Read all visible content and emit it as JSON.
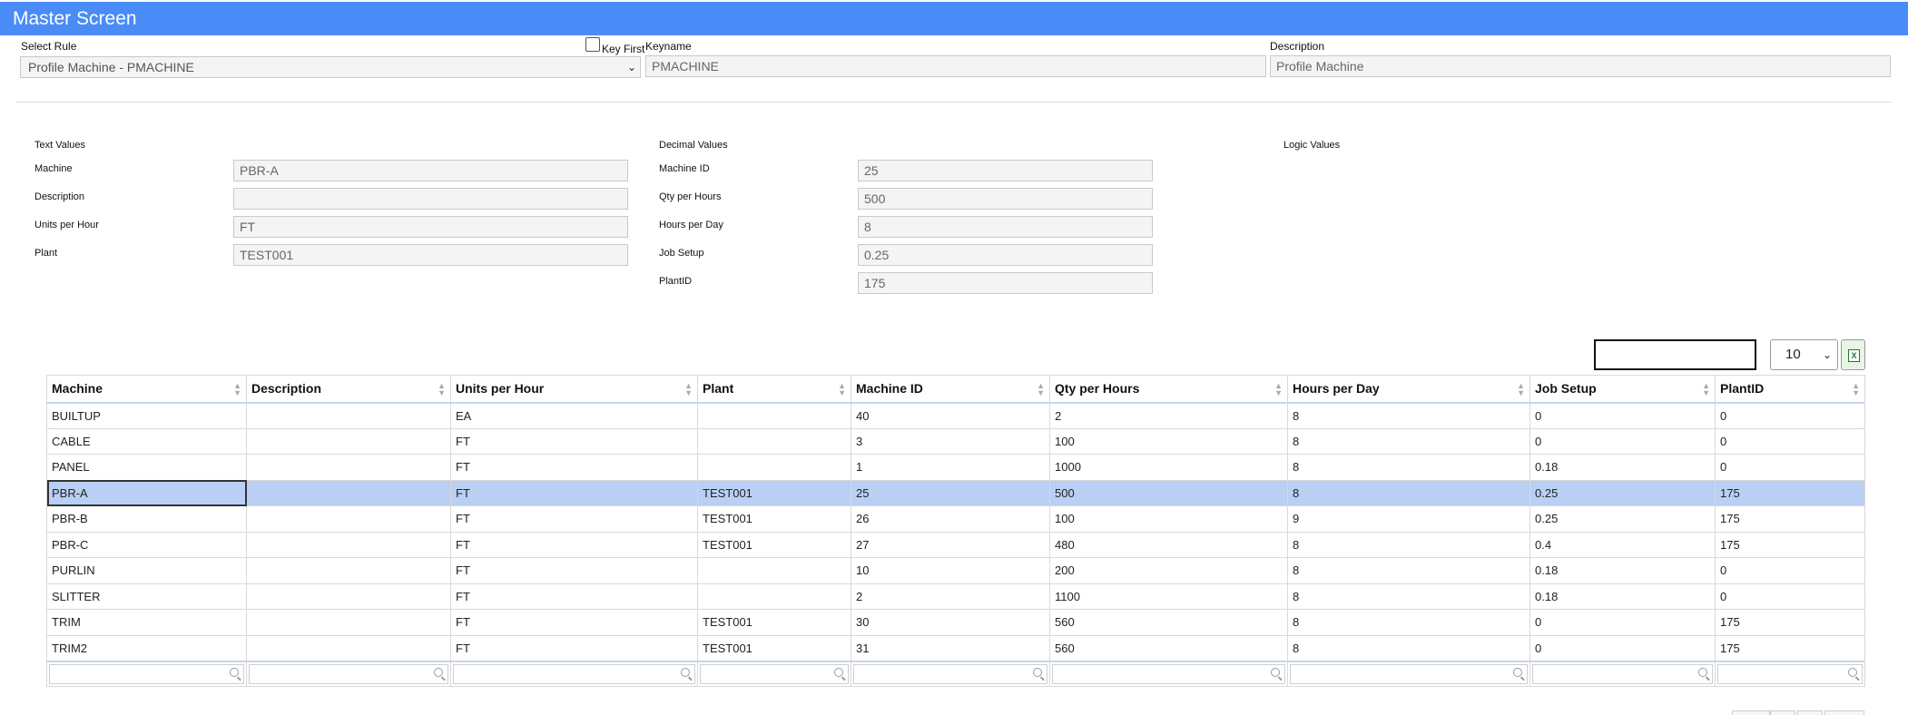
{
  "window": {
    "title": "Master Screen"
  },
  "header": {
    "select_rule_label": "Select Rule",
    "select_rule_value": "Profile Machine - PMACHINE",
    "key_first_label": "Key First",
    "keyname_label": "Keyname",
    "keyname_value": "PMACHINE",
    "description_label": "Description",
    "description_value": "Profile Machine"
  },
  "text_values": {
    "title": "Text Values",
    "fields": [
      {
        "label": "Machine",
        "value": "PBR-A"
      },
      {
        "label": "Description",
        "value": ""
      },
      {
        "label": "Units per Hour",
        "value": "FT"
      },
      {
        "label": "Plant",
        "value": "TEST001"
      }
    ]
  },
  "decimal_values": {
    "title": "Decimal Values",
    "fields": [
      {
        "label": "Machine ID",
        "value": "25"
      },
      {
        "label": "Qty per Hours",
        "value": "500"
      },
      {
        "label": "Hours per Day",
        "value": "8"
      },
      {
        "label": "Job Setup",
        "value": "0.25"
      },
      {
        "label": "PlantID",
        "value": "175"
      }
    ]
  },
  "logic_values": {
    "title": "Logic Values"
  },
  "grid": {
    "search_value": "",
    "page_size": "10",
    "excel_icon": "excel-export-icon",
    "columns": [
      "Machine",
      "Description",
      "Units per Hour",
      "Plant",
      "Machine ID",
      "Qty per Hours",
      "Hours per Day",
      "Job Setup",
      "PlantID"
    ],
    "rows": [
      [
        "BUILTUP",
        "",
        "EA",
        "",
        "40",
        "2",
        "8",
        "0",
        "0"
      ],
      [
        "CABLE",
        "",
        "FT",
        "",
        "3",
        "100",
        "8",
        "0",
        "0"
      ],
      [
        "PANEL",
        "",
        "FT",
        "",
        "1",
        "1000",
        "8",
        "0.18",
        "0"
      ],
      [
        "PBR-A",
        "",
        "FT",
        "TEST001",
        "25",
        "500",
        "8",
        "0.25",
        "175"
      ],
      [
        "PBR-B",
        "",
        "FT",
        "TEST001",
        "26",
        "100",
        "9",
        "0.25",
        "175"
      ],
      [
        "PBR-C",
        "",
        "FT",
        "TEST001",
        "27",
        "480",
        "8",
        "0.4",
        "175"
      ],
      [
        "PURLIN",
        "",
        "FT",
        "",
        "10",
        "200",
        "8",
        "0.18",
        "0"
      ],
      [
        "SLITTER",
        "",
        "FT",
        "",
        "2",
        "1100",
        "8",
        "0.18",
        "0"
      ],
      [
        "TRIM",
        "",
        "FT",
        "TEST001",
        "30",
        "560",
        "8",
        "0",
        "175"
      ],
      [
        "TRIM2",
        "",
        "FT",
        "TEST001",
        "31",
        "560",
        "8",
        "0",
        "175"
      ]
    ],
    "selected_row": 3
  },
  "colors": {
    "titlebar": "#4a8cf7",
    "selected_row": "#b9cff3"
  }
}
